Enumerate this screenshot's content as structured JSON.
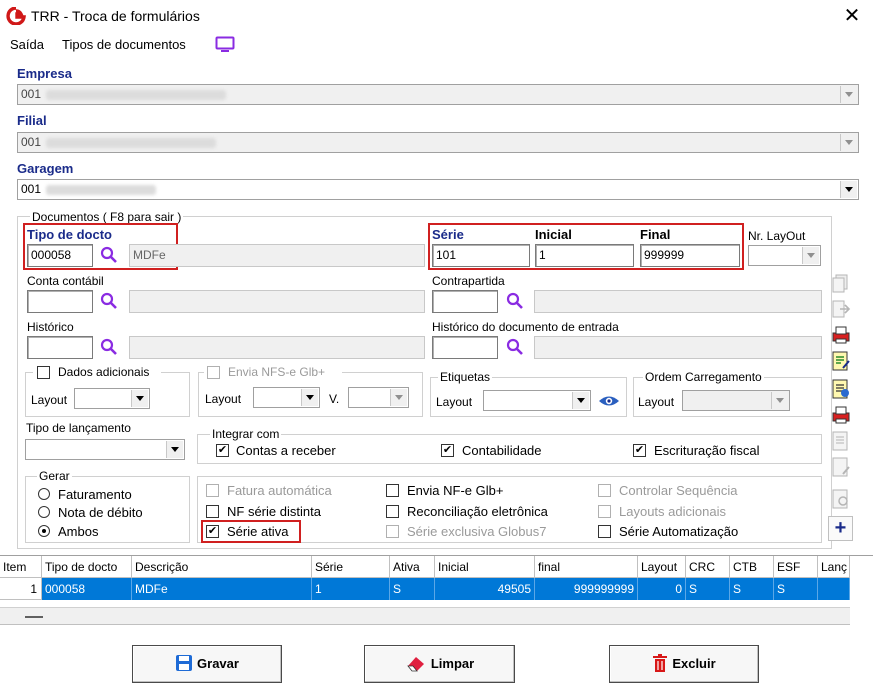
{
  "window": {
    "title": "TRR - Troca de formulários",
    "close": "✕"
  },
  "menu": {
    "items": [
      "Saída",
      "Tipos de documentos"
    ]
  },
  "empresa": {
    "label": "Empresa",
    "value": "001"
  },
  "filial": {
    "label": "Filial",
    "value": "001"
  },
  "garagem": {
    "label": "Garagem",
    "value": "001"
  },
  "documentos": {
    "group_title": "Documentos ( F8 para sair )",
    "tipo_docto": {
      "label": "Tipo de docto",
      "code": "000058",
      "desc": "MDFe"
    },
    "serie": {
      "label": "Série",
      "value": "101"
    },
    "inicial": {
      "label": "Inicial",
      "value": "1"
    },
    "final": {
      "label": "Final",
      "value": "999999"
    },
    "nr_layout": {
      "label": "Nr. LayOut",
      "value": ""
    },
    "conta_contabil": {
      "label": "Conta contábil"
    },
    "contrapartida": {
      "label": "Contrapartida"
    },
    "historico": {
      "label": "Histórico"
    },
    "historico_entrada": {
      "label": "Histórico do documento de entrada"
    },
    "dados_adicionais": {
      "label": "Dados adicionais",
      "layout_label": "Layout"
    },
    "envia_nfse": {
      "label": "Envia NFS-e Glb+",
      "layout_label": "Layout",
      "v_label": "V."
    },
    "etiquetas": {
      "label": "Etiquetas",
      "layout_label": "Layout"
    },
    "ordem_carregamento": {
      "label": "Ordem Carregamento",
      "layout_label": "Layout"
    },
    "tipo_lancamento": {
      "label": "Tipo de lançamento"
    },
    "integrar": {
      "title": "Integrar com",
      "items": [
        {
          "label": "Contas a receber",
          "checked": true
        },
        {
          "label": "Contabilidade",
          "checked": true
        },
        {
          "label": "Escrituração fiscal",
          "checked": true
        }
      ]
    },
    "gerar": {
      "title": "Gerar",
      "options": [
        {
          "label": "Faturamento",
          "selected": false
        },
        {
          "label": "Nota de débito",
          "selected": false
        },
        {
          "label": "Ambos",
          "selected": true
        }
      ]
    },
    "options": {
      "col1": [
        {
          "label": "Fatura automática",
          "checked": false,
          "enabled": false
        },
        {
          "label": "NF série distinta",
          "checked": false,
          "enabled": true
        },
        {
          "label": "Série ativa",
          "checked": true,
          "enabled": true
        }
      ],
      "col2": [
        {
          "label": "Envia NF-e Glb+",
          "checked": false,
          "enabled": true
        },
        {
          "label": "Reconciliação eletrônica",
          "checked": false,
          "enabled": true
        },
        {
          "label": "Série exclusiva Globus7",
          "checked": false,
          "enabled": false
        }
      ],
      "col3": [
        {
          "label": "Controlar Sequência",
          "checked": false,
          "enabled": false
        },
        {
          "label": "Layouts adicionais",
          "checked": false,
          "enabled": false
        },
        {
          "label": "Série Automatização",
          "checked": false,
          "enabled": true
        }
      ]
    }
  },
  "grid": {
    "headers": [
      "Item",
      "Tipo de docto",
      "Descrição",
      "Série",
      "Ativa",
      "Inicial",
      "final",
      "Layout",
      "CRC",
      "CTB",
      "ESF",
      "Lanç"
    ],
    "rows": [
      [
        "1",
        "000058",
        "MDFe",
        "1",
        "S",
        "49505",
        "999999999",
        "0",
        "S",
        "S",
        "S",
        ""
      ]
    ]
  },
  "buttons": {
    "gravar": "Gravar",
    "limpar": "Limpar",
    "excluir": "Excluir"
  },
  "colors": {
    "label_blue": "#1a2b8a",
    "selection": "#0078d7",
    "highlight_red": "#d02020",
    "search_purple": "#8a2be2"
  }
}
